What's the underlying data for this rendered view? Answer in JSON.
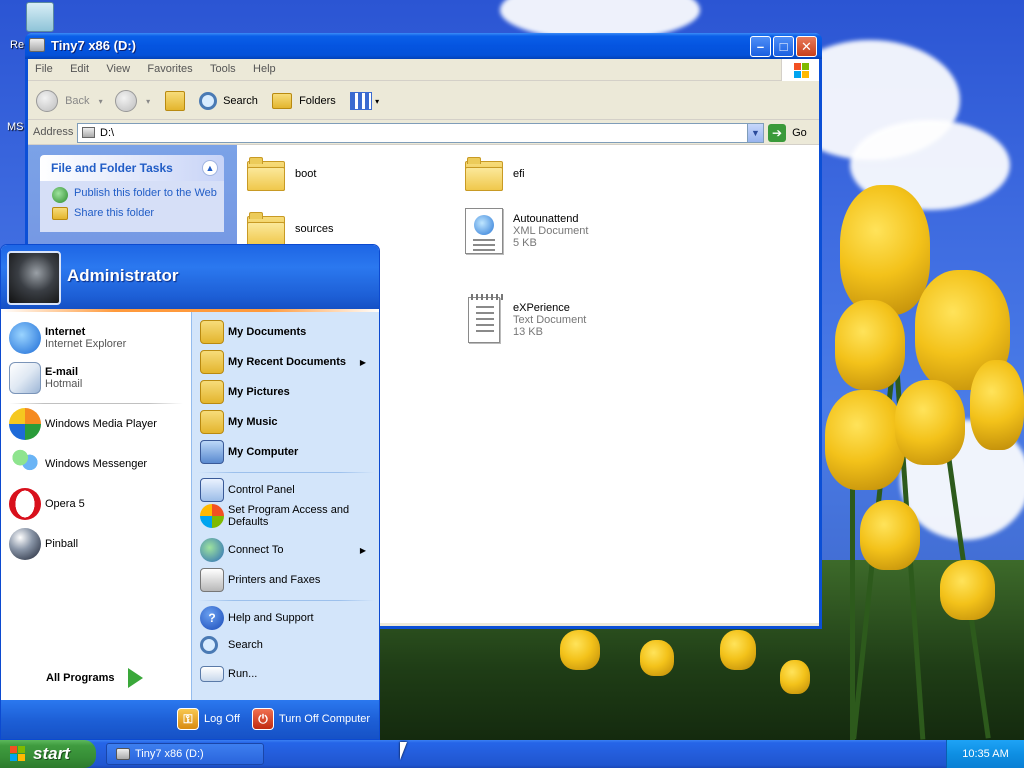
{
  "desktop": {
    "icons": [
      {
        "label": "Re"
      },
      {
        "label": "MS"
      }
    ]
  },
  "explorer": {
    "title": "Tiny7 x86 (D:)",
    "menu": [
      "File",
      "Edit",
      "View",
      "Favorites",
      "Tools",
      "Help"
    ],
    "toolbar": {
      "back": "Back",
      "search": "Search",
      "folders": "Folders"
    },
    "address": {
      "label": "Address",
      "value": "D:\\",
      "go": "Go"
    },
    "tasks": {
      "header": "File and Folder Tasks",
      "items": [
        "Publish this folder to the Web",
        "Share this folder"
      ]
    },
    "files": [
      {
        "name": "boot",
        "type": "",
        "size": ""
      },
      {
        "name": "efi",
        "type": "",
        "size": ""
      },
      {
        "name": "sources",
        "type": "",
        "size": ""
      },
      {
        "name": "Autounattend",
        "type": "XML Document",
        "size": "5 KB"
      },
      {
        "name": "eXPerience",
        "type": "Text Document",
        "size": "13 KB"
      }
    ]
  },
  "startmenu": {
    "user": "Administrator",
    "pinned": [
      {
        "title": "Internet",
        "sub": "Internet Explorer"
      },
      {
        "title": "E-mail",
        "sub": "Hotmail"
      }
    ],
    "recent": [
      "Windows Media Player",
      "Windows Messenger",
      "Opera 5",
      "Pinball"
    ],
    "all_programs": "All Programs",
    "right": {
      "my_documents": "My Documents",
      "my_recent_documents": "My Recent Documents",
      "my_pictures": "My Pictures",
      "my_music": "My Music",
      "my_computer": "My Computer",
      "control_panel": "Control Panel",
      "set_program_access": "Set Program Access and Defaults",
      "connect_to": "Connect To",
      "printers": "Printers and Faxes",
      "help": "Help and Support",
      "search": "Search",
      "run": "Run..."
    },
    "log_off": "Log Off",
    "turn_off": "Turn Off Computer"
  },
  "taskbar": {
    "start": "start",
    "task": "Tiny7 x86 (D:)",
    "clock": "10:35 AM"
  },
  "colors": {
    "xp_blue": "#0a5fe8",
    "start_green": "#3f9b3f",
    "task_link": "#215dc6"
  }
}
